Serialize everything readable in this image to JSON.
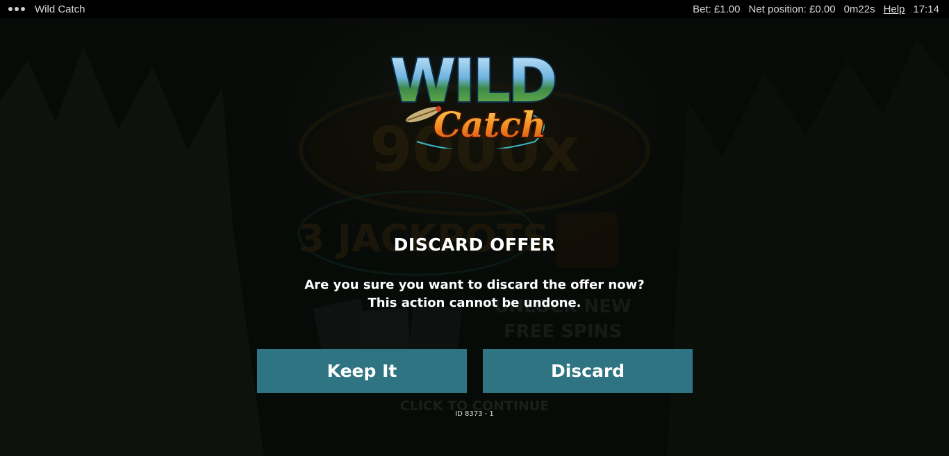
{
  "topbar": {
    "menu_icon": "more-dots-icon",
    "game_title": "Wild Catch",
    "bet": "Bet: £1.00",
    "net_position": "Net position: £0.00",
    "session_time": "0m22s",
    "help": "Help",
    "clock": "17:14"
  },
  "logo": {
    "word1": "WILD",
    "word2": "Catch"
  },
  "background": {
    "multiplier_text": "9000x",
    "jackpots_text": "3 JACKPOTS",
    "unlock_line1": "UNLOCK NEW",
    "unlock_line2": "FREE SPINS",
    "continue_text": "CLICK TO CONTINUE"
  },
  "dialog": {
    "title": "DISCARD OFFER",
    "message_line1": "Are you sure you want to discard the offer now?",
    "message_line2": "This action cannot be undone.",
    "keep_label": "Keep It",
    "discard_label": "Discard",
    "id_text": "ID 8373 - 1"
  },
  "colors": {
    "button_bg": "#2f7482",
    "topbar_bg": "#000000",
    "logo_blue": "#5fb6e6",
    "logo_orange": "#f28a1e"
  }
}
